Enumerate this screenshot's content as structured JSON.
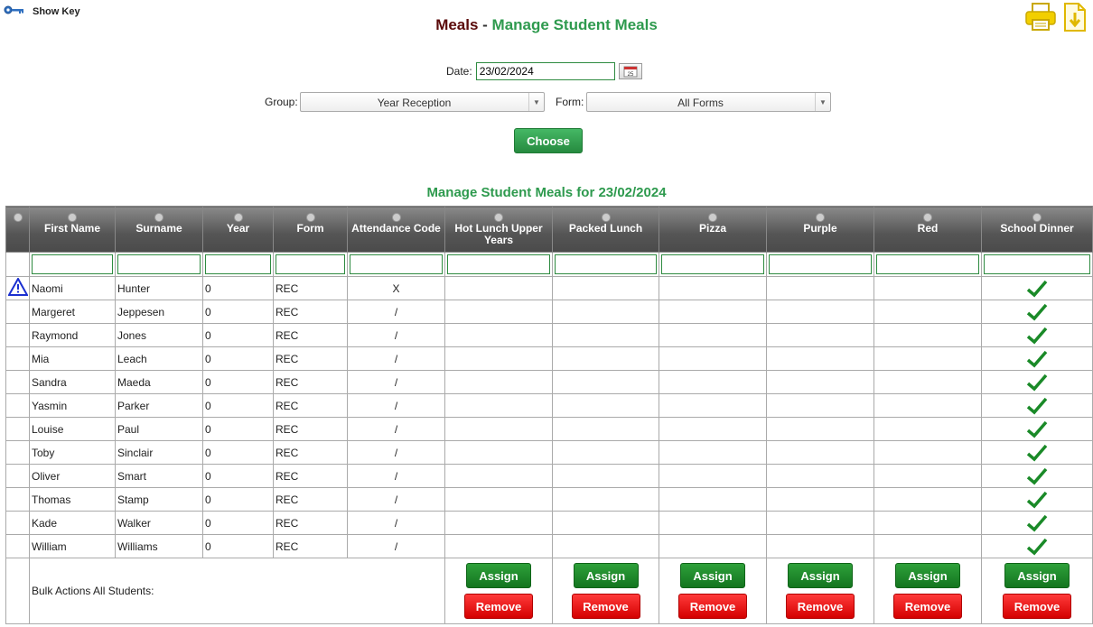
{
  "show_key": {
    "label": "Show Key",
    "icon": "key-icon"
  },
  "top_icons": [
    "printer-icon",
    "download-icon"
  ],
  "title": {
    "part1": "Meals",
    "separator": " - ",
    "part2": "Manage Student Meals"
  },
  "filters": {
    "date_label": "Date:",
    "date_value": "23/02/2024",
    "calendar_icon": "calendar-icon",
    "group_label": "Group:",
    "group_value": "Year Reception",
    "form_label": "Form:",
    "form_value": "All Forms",
    "choose_label": "Choose"
  },
  "subtitle": "Manage Student Meals for 23/02/2024",
  "columns": [
    "First Name",
    "Surname",
    "Year",
    "Form",
    "Attendance Code",
    "Hot Lunch Upper Years",
    "Packed Lunch",
    "Pizza",
    "Purple",
    "Red",
    "School Dinner"
  ],
  "rows": [
    {
      "warning": true,
      "first": "Naomi",
      "surname": "Hunter",
      "year": "0",
      "form": "REC",
      "attendance": "X",
      "school_dinner": true
    },
    {
      "warning": false,
      "first": "Margeret",
      "surname": "Jeppesen",
      "year": "0",
      "form": "REC",
      "attendance": "/",
      "school_dinner": true
    },
    {
      "warning": false,
      "first": "Raymond",
      "surname": "Jones",
      "year": "0",
      "form": "REC",
      "attendance": "/",
      "school_dinner": true
    },
    {
      "warning": false,
      "first": "Mia",
      "surname": "Leach",
      "year": "0",
      "form": "REC",
      "attendance": "/",
      "school_dinner": true
    },
    {
      "warning": false,
      "first": "Sandra",
      "surname": "Maeda",
      "year": "0",
      "form": "REC",
      "attendance": "/",
      "school_dinner": true
    },
    {
      "warning": false,
      "first": "Yasmin",
      "surname": "Parker",
      "year": "0",
      "form": "REC",
      "attendance": "/",
      "school_dinner": true
    },
    {
      "warning": false,
      "first": "Louise",
      "surname": "Paul",
      "year": "0",
      "form": "REC",
      "attendance": "/",
      "school_dinner": true
    },
    {
      "warning": false,
      "first": "Toby",
      "surname": "Sinclair",
      "year": "0",
      "form": "REC",
      "attendance": "/",
      "school_dinner": true
    },
    {
      "warning": false,
      "first": "Oliver",
      "surname": "Smart",
      "year": "0",
      "form": "REC",
      "attendance": "/",
      "school_dinner": true
    },
    {
      "warning": false,
      "first": "Thomas",
      "surname": "Stamp",
      "year": "0",
      "form": "REC",
      "attendance": "/",
      "school_dinner": true
    },
    {
      "warning": false,
      "first": "Kade",
      "surname": "Walker",
      "year": "0",
      "form": "REC",
      "attendance": "/",
      "school_dinner": true
    },
    {
      "warning": false,
      "first": "William",
      "surname": "Williams",
      "year": "0",
      "form": "REC",
      "attendance": "/",
      "school_dinner": true
    }
  ],
  "bulk": {
    "label": "Bulk Actions All Students:",
    "assign_label": "Assign",
    "remove_label": "Remove"
  },
  "colors": {
    "title_dark": "#5a0a0a",
    "accent_green": "#2e9a4e",
    "assign_green": "#14751f",
    "remove_red": "#e00000",
    "tick_green": "#1a8a28"
  }
}
